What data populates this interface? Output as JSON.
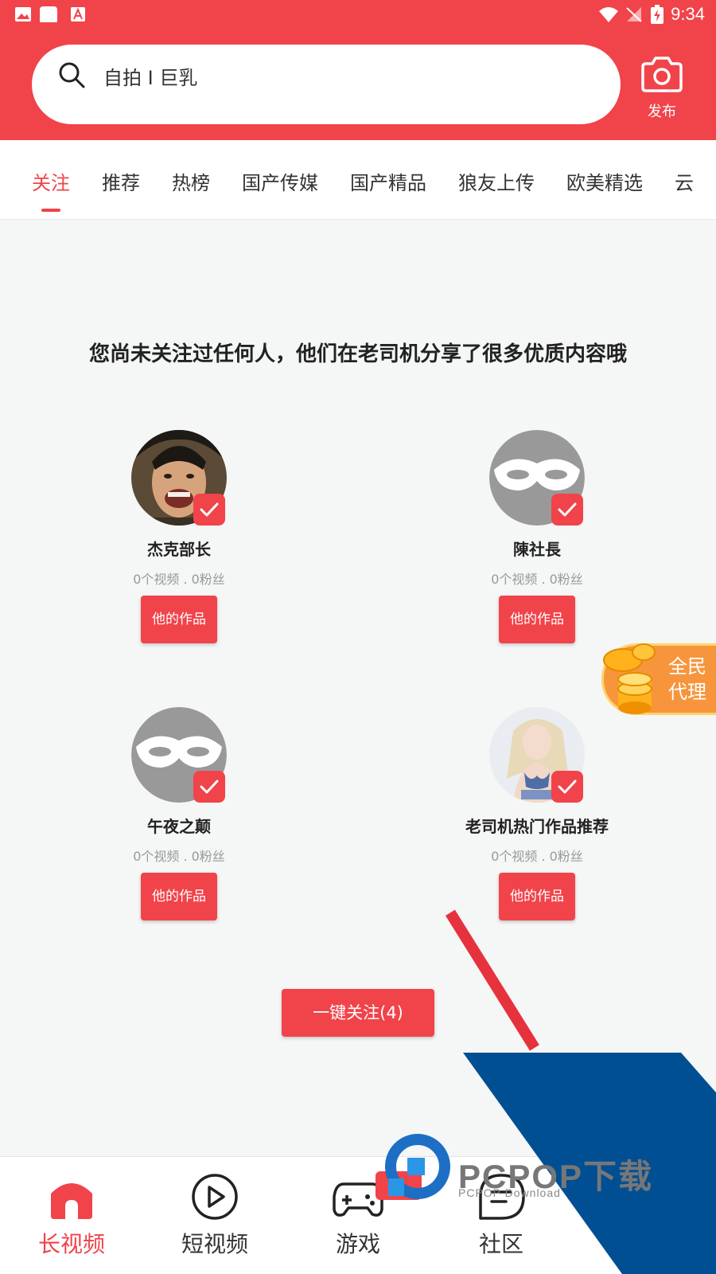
{
  "status_bar": {
    "time": "9:34",
    "icons": [
      "image-icon",
      "square-app-icon",
      "font-app-icon",
      "wifi-icon",
      "no-signal-icon",
      "battery-charging-icon"
    ]
  },
  "header": {
    "search_text": "自拍 I 巨乳",
    "publish_label": "发布"
  },
  "tabs": [
    {
      "label": "关注",
      "active": true
    },
    {
      "label": "推荐"
    },
    {
      "label": "热榜"
    },
    {
      "label": "国产传媒"
    },
    {
      "label": "国产精品"
    },
    {
      "label": "狼友上传"
    },
    {
      "label": "欧美精选"
    },
    {
      "label": "云"
    }
  ],
  "main": {
    "headline": "您尚未关注过任何人，他们在老司机分享了很多优质内容哦",
    "users": [
      {
        "name": "杰克部长",
        "stats": "0个视频 . 0粉丝",
        "button": "他的作品",
        "avatar": "photo-avatar"
      },
      {
        "name": "陳社長",
        "stats": "0个视频 . 0粉丝",
        "button": "他的作品",
        "avatar": "mask-avatar"
      },
      {
        "name": "午夜之颠",
        "stats": "0个视频 . 0粉丝",
        "button": "他的作品",
        "avatar": "mask-avatar"
      },
      {
        "name": "老司机热门作品推荐",
        "stats": "0个视频 . 0粉丝",
        "button": "他的作品",
        "avatar": "photo-avatar"
      }
    ],
    "follow_all_label": "一键关注(4)"
  },
  "promo": {
    "label": "全民代理"
  },
  "bottom_nav": [
    {
      "label": "长视频",
      "icon": "home-icon",
      "active": true
    },
    {
      "label": "短视频",
      "icon": "play-circle-icon"
    },
    {
      "label": "游戏",
      "icon": "gamepad-icon",
      "badge": "送"
    },
    {
      "label": "社区",
      "icon": "chat-bubble-icon"
    }
  ],
  "watermark": {
    "text": "PCPOP下载",
    "sub": "PCPOP Download"
  },
  "colors": {
    "brand_red": "#f1434a",
    "background": "#f5f6f6",
    "mask_gray": "#999999",
    "watermark_blue": "#004f93",
    "promo_orange": "#f7953c"
  }
}
